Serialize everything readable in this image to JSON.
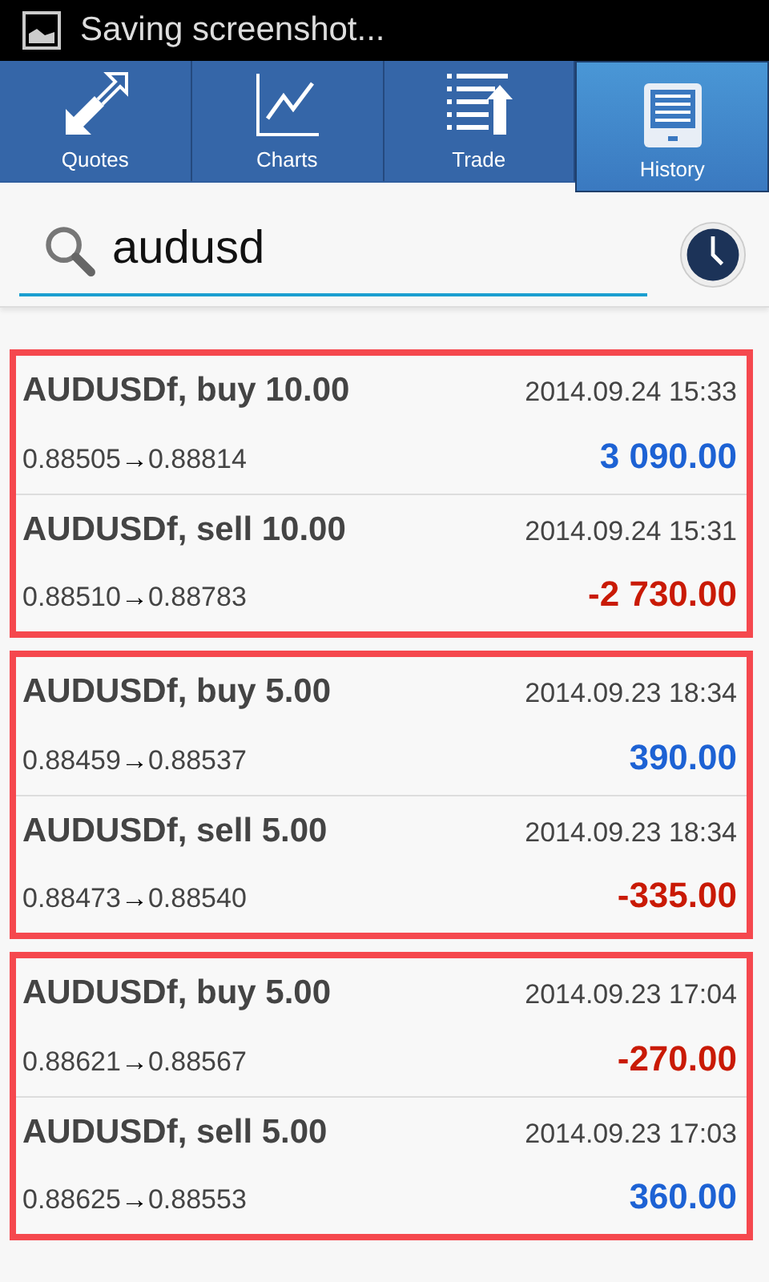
{
  "status_bar": {
    "notification": "Saving screenshot..."
  },
  "tabs": [
    {
      "label": "Quotes",
      "selected": false
    },
    {
      "label": "Charts",
      "selected": false
    },
    {
      "label": "Trade",
      "selected": false
    },
    {
      "label": "History",
      "selected": true
    }
  ],
  "search": {
    "value": "audusd"
  },
  "groups": [
    {
      "deals": [
        {
          "title": "AUDUSDf, buy 10.00",
          "time": "2014.09.24 15:33",
          "open_price": "0.88505",
          "close_price": "0.88814",
          "profit": "3 090.00",
          "color": "#1d62d4"
        },
        {
          "title": "AUDUSDf, sell 10.00",
          "time": "2014.09.24 15:31",
          "open_price": "0.88510",
          "close_price": "0.88783",
          "profit": "-2 730.00",
          "color": "#c91a05"
        }
      ]
    },
    {
      "deals": [
        {
          "title": "AUDUSDf, buy 5.00",
          "time": "2014.09.23 18:34",
          "open_price": "0.88459",
          "close_price": "0.88537",
          "profit": "390.00",
          "color": "#1d62d4"
        },
        {
          "title": "AUDUSDf, sell 5.00",
          "time": "2014.09.23 18:34",
          "open_price": "0.88473",
          "close_price": "0.88540",
          "profit": "-335.00",
          "color": "#c91a05"
        }
      ]
    },
    {
      "deals": [
        {
          "title": "AUDUSDf, buy 5.00",
          "time": "2014.09.23 17:04",
          "open_price": "0.88621",
          "close_price": "0.88567",
          "profit": "-270.00",
          "color": "#c91a05"
        },
        {
          "title": "AUDUSDf, sell 5.00",
          "time": "2014.09.23 17:03",
          "open_price": "0.88625",
          "close_price": "0.88553",
          "profit": "360.00",
          "color": "#1d62d4"
        }
      ]
    }
  ],
  "arrow": "→"
}
